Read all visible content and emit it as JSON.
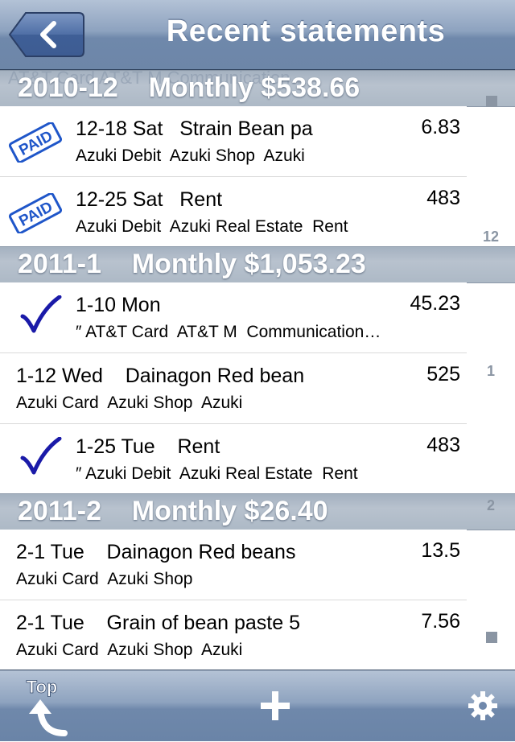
{
  "nav": {
    "title": "Recent statements",
    "back_icon": "chevron-left-icon"
  },
  "sections": [
    {
      "label": "2010-12    Monthly $538.66",
      "ghost_text": "AT&T Card  AT&T M  Communication…",
      "rows": [
        {
          "status": "paid",
          "line1": "12-18 Sat   Strain Bean pa",
          "line2": "Azuki Debit  Azuki Shop  Azuki",
          "amount": "6.83",
          "badge": "PAID"
        },
        {
          "status": "paid",
          "line1": "12-25 Sat   Rent",
          "line2": "Azuki Debit  Azuki Real Estate  Rent",
          "amount": "483",
          "badge": "PAID"
        }
      ]
    },
    {
      "label": "2011-1    Monthly $1,053.23",
      "rows": [
        {
          "status": "check",
          "line1": "1-10 Mon",
          "line2": "″ AT&T Card  AT&T M  Communication…",
          "amount": "45.23"
        },
        {
          "status": "none",
          "line1": "1-12 Wed    Dainagon Red bean",
          "line2": "Azuki Card  Azuki Shop  Azuki",
          "amount": "525"
        },
        {
          "status": "check",
          "line1": "1-25 Tue    Rent",
          "line2": "″ Azuki Debit  Azuki Real Estate  Rent",
          "amount": "483"
        }
      ]
    },
    {
      "label": "2011-2    Monthly $26.40",
      "rows": [
        {
          "status": "none",
          "line1": "2-1 Tue    Dainagon Red beans",
          "line2": "Azuki Card  Azuki Shop",
          "amount": "13.5"
        },
        {
          "status": "none",
          "line1": "2-1 Tue    Grain of bean paste 5",
          "line2": "Azuki Card  Azuki Shop  Azuki",
          "amount": "7.56"
        }
      ]
    }
  ],
  "index_bar": [
    "12",
    "1",
    "2"
  ],
  "toolbar": {
    "top_label": "Top",
    "add_icon": "plus-icon",
    "settings_icon": "gear-icon"
  },
  "colors": {
    "nav_bar": "#8da2bf",
    "section_header": "#adb9c6",
    "paid_stamp": "#1f56c9",
    "checkmark": "#1a1aa8"
  }
}
